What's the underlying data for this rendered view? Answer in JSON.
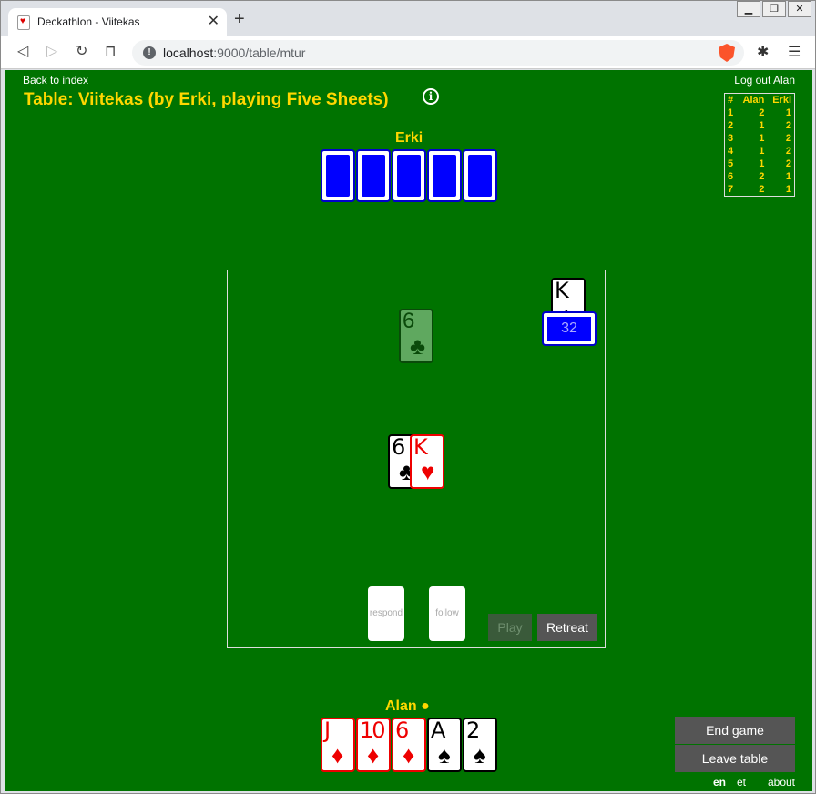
{
  "browser": {
    "tab_title": "Deckathlon - Viitekas",
    "url_host": "localhost",
    "url_rest": ":9000/table/mtur"
  },
  "nav": {
    "back_label": "Back to index",
    "logout_label": "Log out Alan"
  },
  "table": {
    "title": "Table: Viitekas (by Erki, playing Five Sheets)"
  },
  "scoreboard": {
    "headers": [
      "#",
      "Alan",
      "Erki"
    ],
    "rows": [
      [
        "1",
        "2",
        "1"
      ],
      [
        "2",
        "1",
        "2"
      ],
      [
        "3",
        "1",
        "2"
      ],
      [
        "4",
        "1",
        "2"
      ],
      [
        "5",
        "1",
        "2"
      ],
      [
        "6",
        "2",
        "1"
      ],
      [
        "7",
        "2",
        "1"
      ]
    ]
  },
  "opponent": {
    "name": "Erki",
    "card_count": 5
  },
  "player": {
    "name": "Alan ●",
    "hand": [
      {
        "rank": "J",
        "suit": "♦",
        "color": "red"
      },
      {
        "rank": "10",
        "suit": "♦",
        "color": "red"
      },
      {
        "rank": "6",
        "suit": "♦",
        "color": "red"
      },
      {
        "rank": "A",
        "suit": "♠",
        "color": "black"
      },
      {
        "rank": "2",
        "suit": "♠",
        "color": "black"
      }
    ]
  },
  "board": {
    "trump_card": {
      "rank": "K",
      "suit": "♠"
    },
    "deck_count": "32",
    "ghost_card": {
      "rank": "6",
      "suit": "♣"
    },
    "played_cards": [
      {
        "rank": "6",
        "suit": "♣",
        "color": "black"
      },
      {
        "rank": "K",
        "suit": "♥",
        "color": "red"
      }
    ],
    "slot_respond": "respond",
    "slot_follow": "follow",
    "play_label": "Play",
    "retreat_label": "Retreat"
  },
  "actions": {
    "end_game": "End game",
    "leave_table": "Leave table"
  },
  "footer": {
    "lang_en": "en",
    "lang_et": "et",
    "about": "about"
  }
}
